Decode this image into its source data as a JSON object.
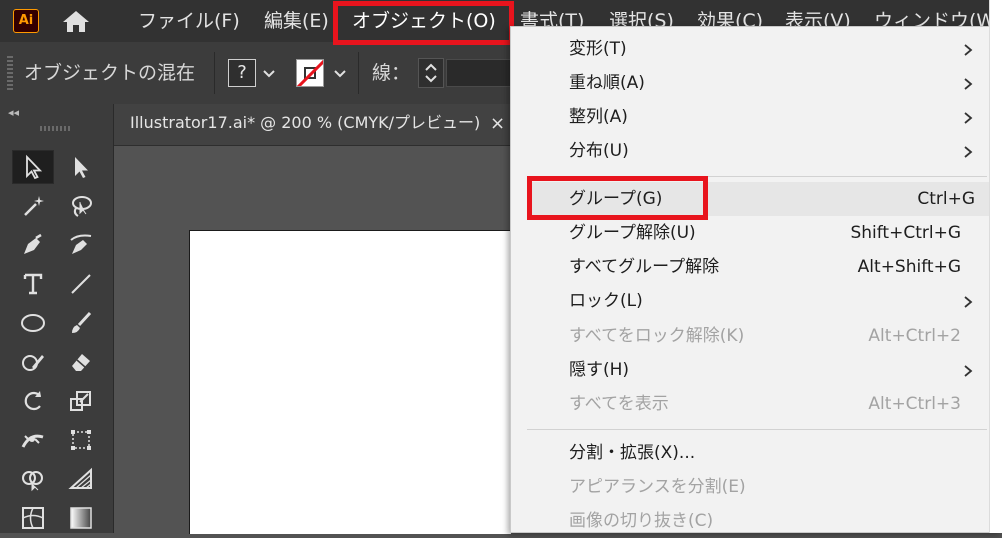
{
  "app": {
    "logo_text": "Ai"
  },
  "menubar": {
    "items": [
      {
        "label": "ファイル(F)"
      },
      {
        "label": "編集(E)"
      },
      {
        "label": "オブジェクト(O)"
      },
      {
        "label": "書式(T)"
      },
      {
        "label": "選択(S)"
      },
      {
        "label": "効果(C)"
      },
      {
        "label": "表示(V)"
      },
      {
        "label": "ウィンドウ(W)"
      }
    ],
    "active_item": "オブジェクト(O)"
  },
  "control_bar": {
    "title": "オブジェクトの混在",
    "fill_indicator": "?",
    "stroke_label": "線："
  },
  "document": {
    "tab_title": "Illustrator17.ai* @ 200 % (CMYK/プレビュー)",
    "close_glyph": "×"
  },
  "object_menu": {
    "items": [
      {
        "label": "変形(T)",
        "shortcut": "",
        "submenu": true,
        "enabled": true
      },
      {
        "label": "重ね順(A)",
        "shortcut": "",
        "submenu": true,
        "enabled": true
      },
      {
        "label": "整列(A)",
        "shortcut": "",
        "submenu": true,
        "enabled": true
      },
      {
        "label": "分布(U)",
        "shortcut": "",
        "submenu": true,
        "enabled": true
      },
      {
        "label": "グループ(G)",
        "shortcut": "Ctrl+G",
        "submenu": false,
        "enabled": true,
        "highlighted": true
      },
      {
        "label": "グループ解除(U)",
        "shortcut": "Shift+Ctrl+G",
        "submenu": false,
        "enabled": true
      },
      {
        "label": "すべてグループ解除",
        "shortcut": "Alt+Shift+G",
        "submenu": false,
        "enabled": true
      },
      {
        "label": "ロック(L)",
        "shortcut": "",
        "submenu": true,
        "enabled": true
      },
      {
        "label": "すべてをロック解除(K)",
        "shortcut": "Alt+Ctrl+2",
        "submenu": false,
        "enabled": false
      },
      {
        "label": "隠す(H)",
        "shortcut": "",
        "submenu": true,
        "enabled": true
      },
      {
        "label": "すべてを表示",
        "shortcut": "Alt+Ctrl+3",
        "submenu": false,
        "enabled": false
      },
      {
        "label": "分割・拡張(X)...",
        "shortcut": "",
        "submenu": false,
        "enabled": true
      },
      {
        "label": "アピアランスを分割(E)",
        "shortcut": "",
        "submenu": false,
        "enabled": false
      },
      {
        "label": "画像の切り抜き(C)",
        "shortcut": "",
        "submenu": false,
        "enabled": false
      }
    ]
  },
  "colors": {
    "highlight_box": "#e8141d",
    "menubar_bg": "#323232",
    "dropdown_bg": "#f2f2f2",
    "ai_logo_orange": "#ff9a00"
  },
  "tools": [
    "selection-tool-icon",
    "direct-selection-tool-icon",
    "magic-wand-icon",
    "lasso-icon",
    "pen-tool-icon",
    "curvature-tool-icon",
    "type-tool-icon",
    "line-segment-tool-icon",
    "ellipse-tool-icon",
    "paintbrush-icon",
    "shaper-tool-icon",
    "eraser-icon",
    "rotate-tool-icon",
    "scale-tool-icon",
    "width-tool-icon",
    "free-transform-icon",
    "shape-builder-icon",
    "perspective-grid-icon",
    "mesh-tool-icon",
    "gradient-tool-icon"
  ]
}
